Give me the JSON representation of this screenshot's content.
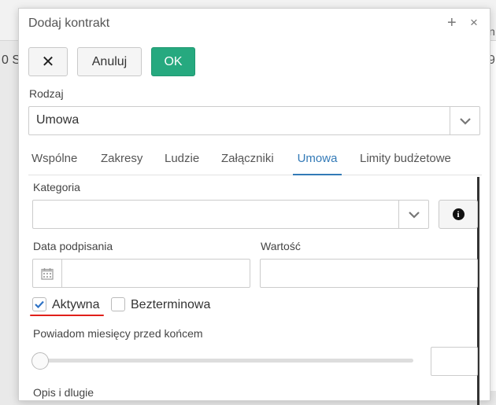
{
  "background": {
    "left_text": "0 S",
    "right_top": "n",
    "right_num": "9"
  },
  "dialog": {
    "title": "Dodaj kontrakt",
    "plus_glyph": "+",
    "close_glyph": "×",
    "toolbar": {
      "x_label": "✕",
      "cancel_label": "Anuluj",
      "ok_label": "OK"
    },
    "rodzaj": {
      "label": "Rodzaj",
      "value": "Umowa"
    },
    "tabs": [
      {
        "label": "Wspólne",
        "active": false
      },
      {
        "label": "Zakresy",
        "active": false
      },
      {
        "label": "Ludzie",
        "active": false
      },
      {
        "label": "Załączniki",
        "active": false
      },
      {
        "label": "Umowa",
        "active": true
      },
      {
        "label": "Limity budżetowe",
        "active": false
      }
    ],
    "kategoria": {
      "label": "Kategoria",
      "value": ""
    },
    "data_podpisania": {
      "label": "Data podpisania",
      "value": ""
    },
    "wartosc": {
      "label": "Wartość",
      "value": ""
    },
    "aktywna": {
      "label": "Aktywna",
      "checked": true
    },
    "bezterminowa": {
      "label": "Bezterminowa",
      "checked": false
    },
    "powiadom": {
      "label": "Powiadom miesięcy przed końcem",
      "slider_fraction": 0,
      "value": ""
    },
    "cut_label": "Opis i dlugie"
  },
  "colors": {
    "accent": "#337ab7",
    "ok_button": "#26a97f",
    "highlight_underline": "#e0201a"
  }
}
